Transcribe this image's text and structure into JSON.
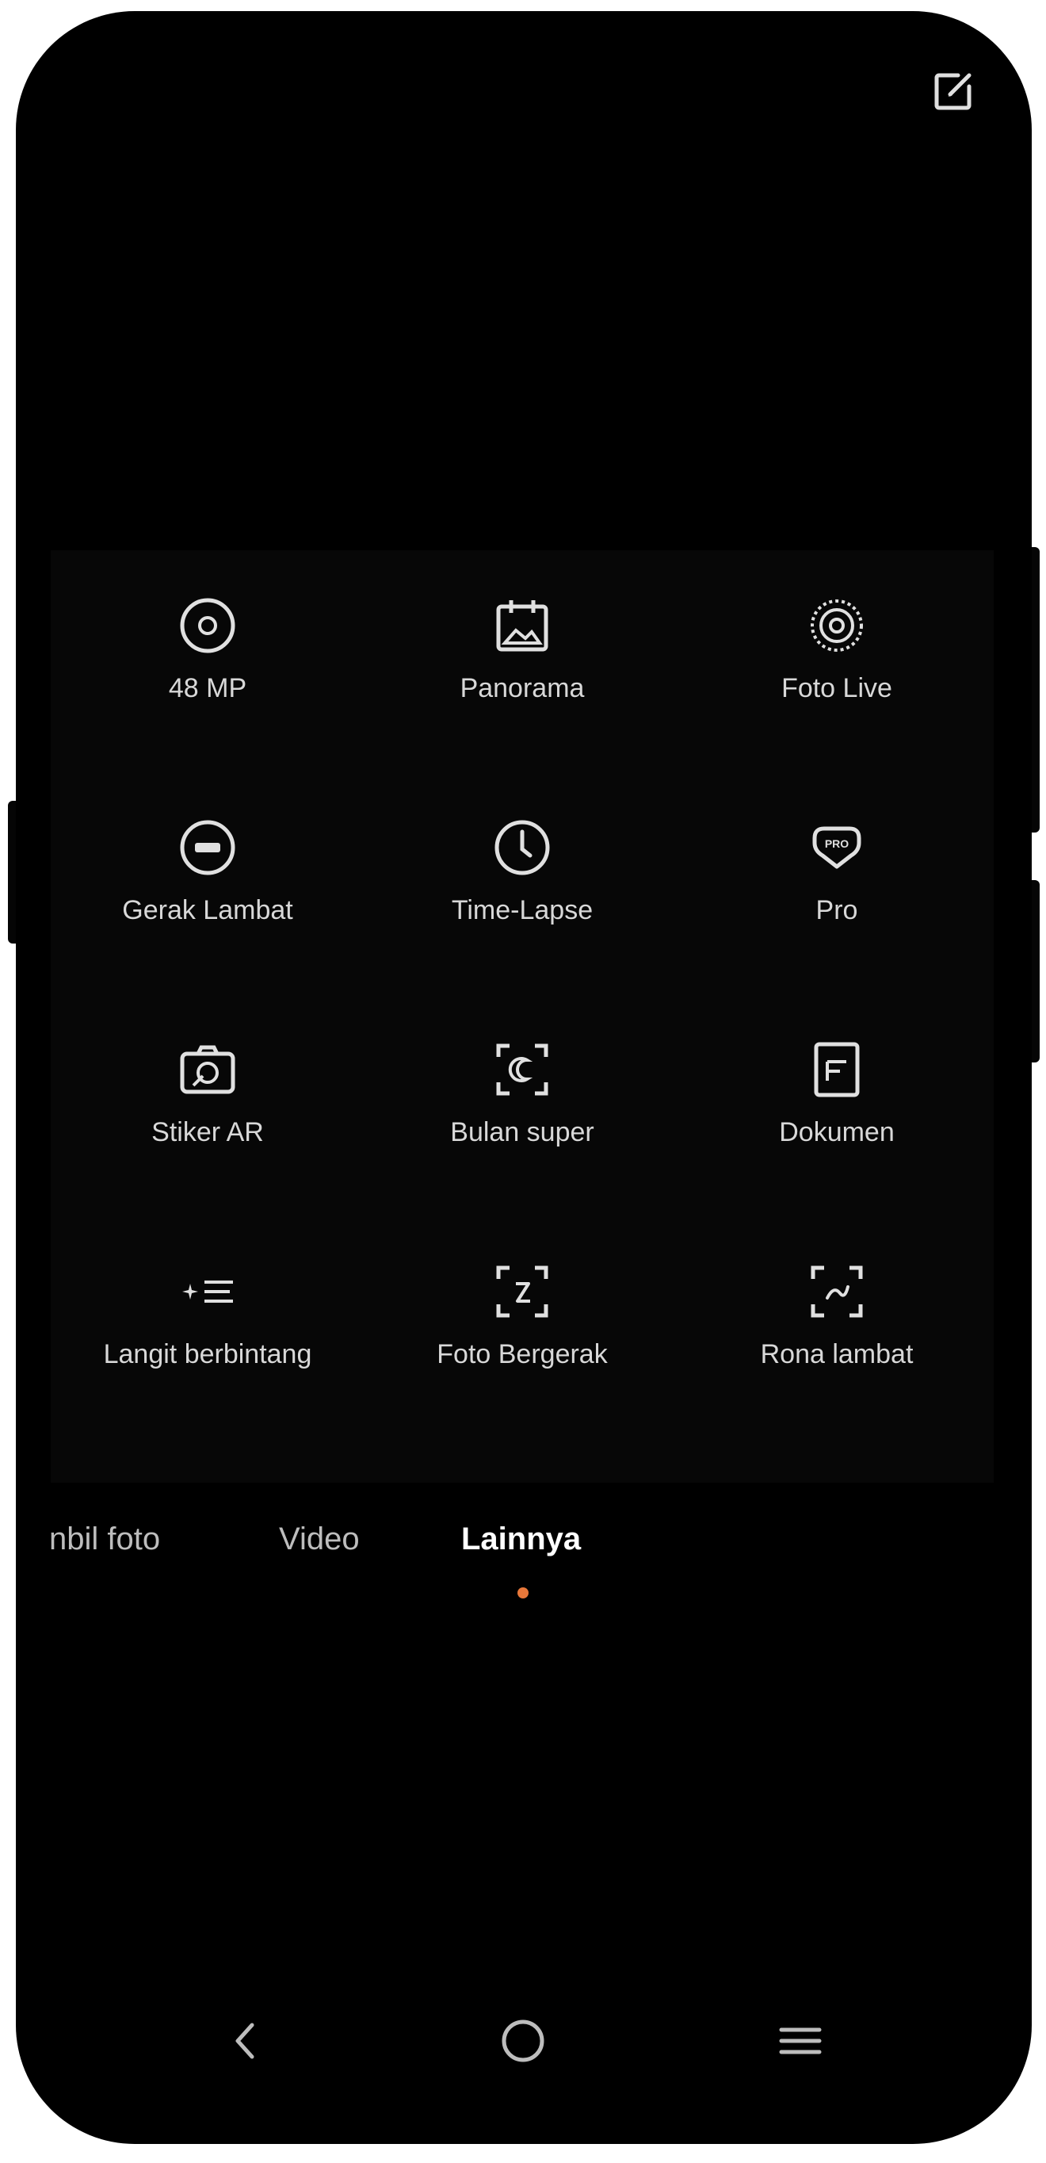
{
  "header": {
    "edit_icon": "edit-icon"
  },
  "modes": [
    {
      "label": "48 MP",
      "icon": "48mp-icon"
    },
    {
      "label": "Panorama",
      "icon": "panorama-icon"
    },
    {
      "label": "Foto Live",
      "icon": "live-photo-icon"
    },
    {
      "label": "Gerak Lambat",
      "icon": "slow-motion-icon"
    },
    {
      "label": "Time-Lapse",
      "icon": "timelapse-icon"
    },
    {
      "label": "Pro",
      "icon": "pro-icon"
    },
    {
      "label": "Stiker AR",
      "icon": "ar-sticker-icon"
    },
    {
      "label": "Bulan super",
      "icon": "super-moon-icon"
    },
    {
      "label": "Dokumen",
      "icon": "document-icon"
    },
    {
      "label": "Langit berbintang",
      "icon": "starry-sky-icon"
    },
    {
      "label": "Foto Bergerak",
      "icon": "moving-photo-icon"
    },
    {
      "label": "Rona lambat",
      "icon": "slow-tone-icon"
    }
  ],
  "tabs": [
    {
      "label": "nbil foto",
      "active": false
    },
    {
      "label": "Video",
      "active": false
    },
    {
      "label": "Lainnya",
      "active": true
    }
  ],
  "nav": {
    "back_icon": "back-icon",
    "home_icon": "home-icon",
    "menu_icon": "menu-icon"
  },
  "colors": {
    "background": "#000000",
    "panel": "#070707",
    "icon_stroke": "#e0e0e0",
    "active_dot": "#e8783a",
    "text": "#d8d8d8"
  }
}
